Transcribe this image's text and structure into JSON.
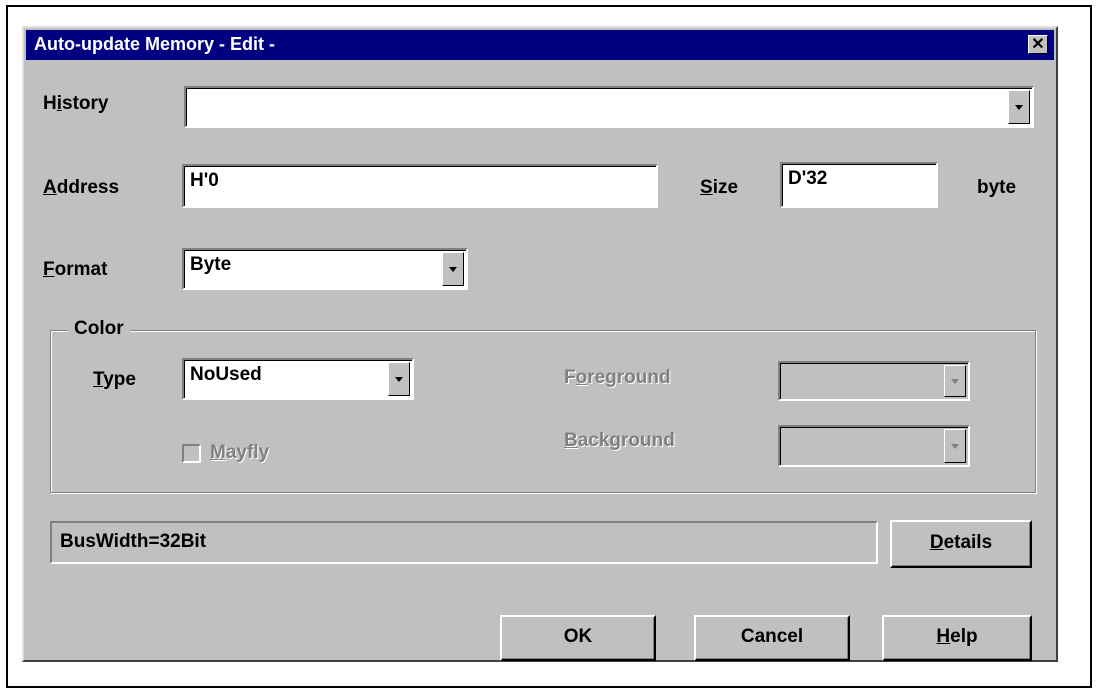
{
  "window": {
    "title": "Auto-update Memory - Edit -",
    "close_glyph": "✕"
  },
  "history": {
    "label_pre": "H",
    "label_key": "i",
    "label_post": "story",
    "value": ""
  },
  "address": {
    "label_key": "A",
    "label_post": "ddress",
    "value": "H'0"
  },
  "size": {
    "label_key": "S",
    "label_post": "ize",
    "value": "D'32",
    "unit": "byte"
  },
  "format": {
    "label_key": "F",
    "label_post": "ormat",
    "value": "Byte"
  },
  "color_group": {
    "label": "Color",
    "type": {
      "label_key": "T",
      "label_post": "ype",
      "value": "NoUsed"
    },
    "mayfly": {
      "label_key": "M",
      "label_post": "ayfly",
      "checked": false
    },
    "foreground": {
      "label_pre": "F",
      "label_key": "o",
      "label_post": "reground",
      "value": ""
    },
    "background": {
      "label_key": "B",
      "label_post": "ackground",
      "value": ""
    }
  },
  "status": {
    "text": "BusWidth=32Bit"
  },
  "buttons": {
    "details_key": "D",
    "details_post": "etails",
    "ok": "OK",
    "cancel": "Cancel",
    "help_key": "H",
    "help_post": "elp"
  }
}
